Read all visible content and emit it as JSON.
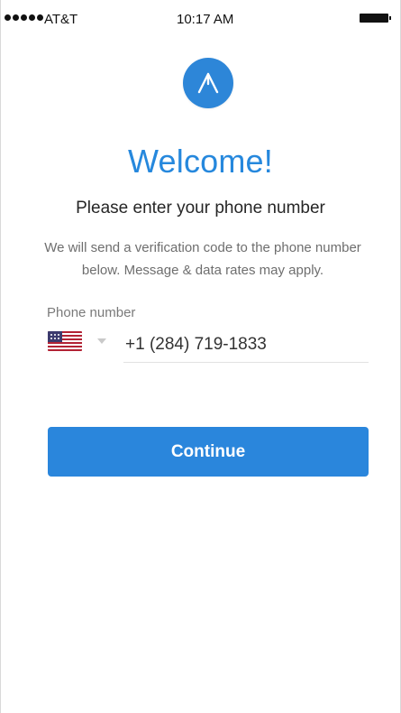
{
  "status_bar": {
    "carrier": "AT&T",
    "time": "10:17 AM"
  },
  "app": {
    "logo_icon": "lambda-mountain-icon",
    "brand_color": "#2d86d8"
  },
  "welcome": {
    "title": "Welcome!",
    "subtitle": "Please enter your phone number",
    "info": "We will send a verification code to the phone number below.  Message & data rates may apply."
  },
  "phone": {
    "label": "Phone number",
    "country_flag": "us-flag-icon",
    "value": "+1 (284) 719-1833"
  },
  "actions": {
    "continue_label": "Continue"
  },
  "colors": {
    "primary": "#2a86dc",
    "title": "#2688dd"
  }
}
